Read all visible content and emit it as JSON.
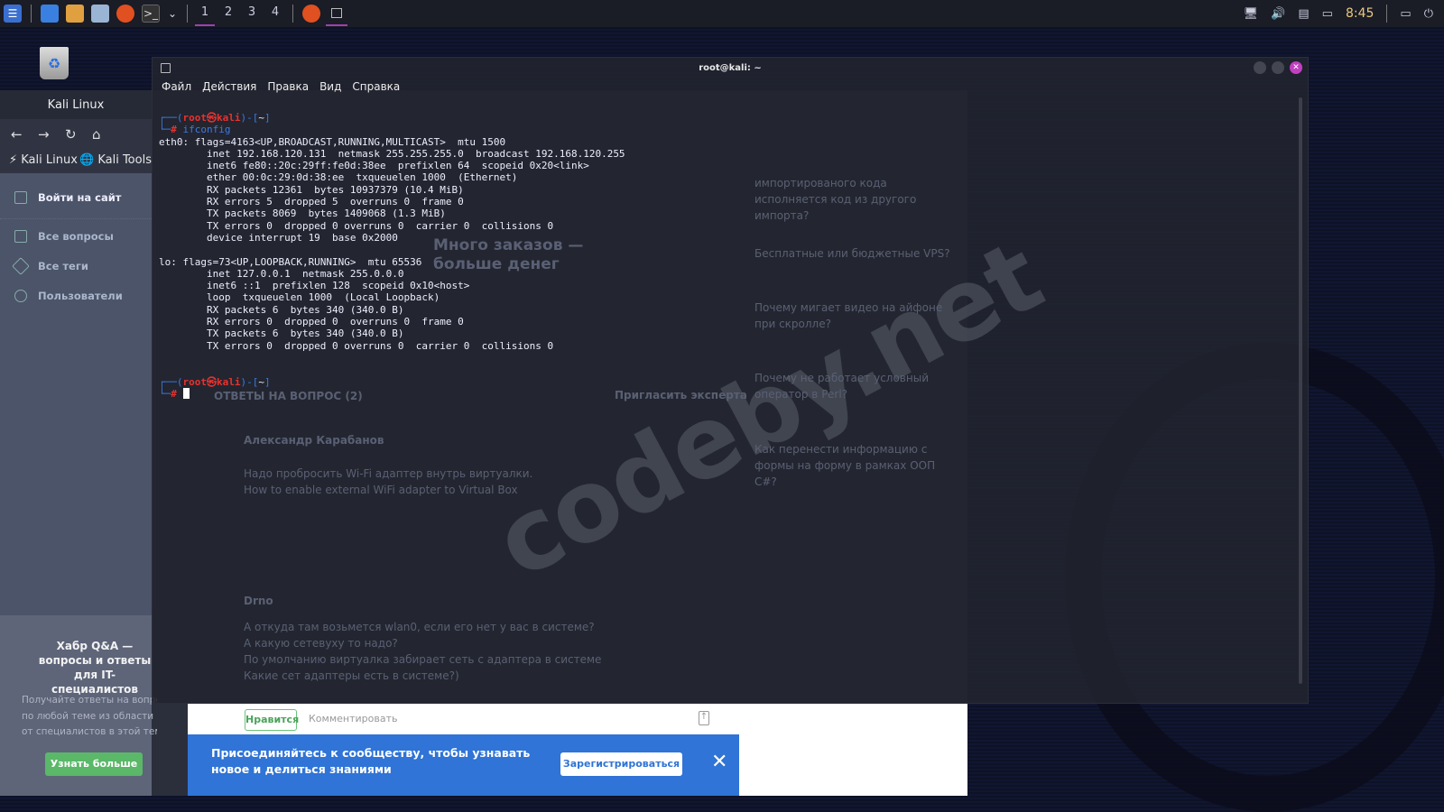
{
  "taskbar": {
    "workspaces": [
      "1",
      "2",
      "3",
      "4"
    ],
    "clock": "8:45",
    "icons": [
      "kali-menu-icon",
      "files-icon",
      "folder-icon",
      "text-editor-icon",
      "firefox-icon",
      "terminal-icon",
      "dropdown-icon"
    ],
    "tray": [
      "network-icon",
      "volume-icon",
      "notifications-icon",
      "battery-icon",
      "show-desktop-icon",
      "power-icon"
    ]
  },
  "browser": {
    "title": "Kali Linux",
    "bookmarks": [
      "Kali Linux",
      "Kali Tools"
    ],
    "sidebar": {
      "login": "Войти на сайт",
      "items": [
        "Все вопросы",
        "Все теги",
        "Пользователи"
      ]
    },
    "promo": {
      "title": "Хабр Q&A — вопросы и ответы для IT-специалистов",
      "lines": [
        "Получайте ответы на вопросы",
        "по любой теме из области IT",
        "от специалистов в этой теме."
      ],
      "button": "Узнать больше"
    },
    "page": {
      "answers_header": "ОТВЕТЫ НА ВОПРОС (2)",
      "invite": "Пригласить эксперта",
      "answer1_author": "Александр Карабанов",
      "answer1_lines": [
        "Надо пробросить Wi-Fi адаптер внутрь виртуалки.",
        "How to enable external WiFi adapter to Virtual Box"
      ],
      "answer2_author": "Drno",
      "answer2_lines": [
        "А откуда там возьмется wlan0, если его нет у вас в системе?",
        "А какую сетевуху то надо?",
        "По умолчанию виртуалка забирает сеть с адаптера в системе",
        "Какие сет адаптеры есть в системе?)"
      ],
      "related": [
        "импортированого кода исполняется код из другого импорта?",
        "Бесплатные или бюджетные VPS?",
        "Почему мигает видео на айфоне при скролле?",
        "Почему не работает условный оператор в Perl?",
        "Как перенести информацию с формы на форму в рамках ООП C#?"
      ],
      "ad_title": "Много заказов — больше денег",
      "like": "Нравится",
      "comment": "Комментировать"
    },
    "banner": {
      "text": "Присоединяйтесь к сообществу, чтобы узнавать новое и делиться знаниями",
      "register": "Зарегистрироваться"
    }
  },
  "terminal": {
    "title": "root@kali: ~",
    "menu": [
      "Файл",
      "Действия",
      "Правка",
      "Вид",
      "Справка"
    ],
    "prompt": {
      "user": "root",
      "host": "kali",
      "dir": "~"
    },
    "command": "ifconfig",
    "output": [
      "eth0: flags=4163<UP,BROADCAST,RUNNING,MULTICAST>  mtu 1500",
      "        inet 192.168.120.131  netmask 255.255.255.0  broadcast 192.168.120.255",
      "        inet6 fe80::20c:29ff:fe0d:38ee  prefixlen 64  scopeid 0x20<link>",
      "        ether 00:0c:29:0d:38:ee  txqueuelen 1000  (Ethernet)",
      "        RX packets 12361  bytes 10937379 (10.4 MiB)",
      "        RX errors 5  dropped 5  overruns 0  frame 0",
      "        TX packets 8069  bytes 1409068 (1.3 MiB)",
      "        TX errors 0  dropped 0 overruns 0  carrier 0  collisions 0",
      "        device interrupt 19  base 0x2000",
      "",
      "lo: flags=73<UP,LOOPBACK,RUNNING>  mtu 65536",
      "        inet 127.0.0.1  netmask 255.0.0.0",
      "        inet6 ::1  prefixlen 128  scopeid 0x10<host>",
      "        loop  txqueuelen 1000  (Local Loopback)",
      "        RX packets 6  bytes 340 (340.0 B)",
      "        RX errors 0  dropped 0  overruns 0  frame 0",
      "        TX packets 6  bytes 340 (340.0 B)",
      "        TX errors 0  dropped 0 overruns 0  carrier 0  collisions 0",
      "",
      ""
    ]
  },
  "watermark": "codeby.net"
}
